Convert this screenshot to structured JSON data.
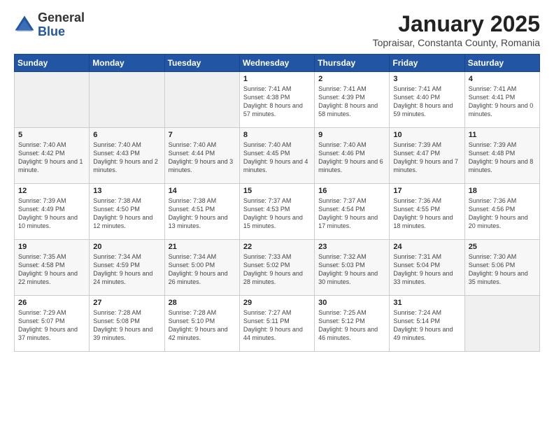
{
  "logo": {
    "general": "General",
    "blue": "Blue"
  },
  "header": {
    "title": "January 2025",
    "subtitle": "Topraisar, Constanta County, Romania"
  },
  "weekdays": [
    "Sunday",
    "Monday",
    "Tuesday",
    "Wednesday",
    "Thursday",
    "Friday",
    "Saturday"
  ],
  "weeks": [
    [
      {
        "day": "",
        "info": ""
      },
      {
        "day": "",
        "info": ""
      },
      {
        "day": "",
        "info": ""
      },
      {
        "day": "1",
        "info": "Sunrise: 7:41 AM\nSunset: 4:38 PM\nDaylight: 8 hours and 57 minutes."
      },
      {
        "day": "2",
        "info": "Sunrise: 7:41 AM\nSunset: 4:39 PM\nDaylight: 8 hours and 58 minutes."
      },
      {
        "day": "3",
        "info": "Sunrise: 7:41 AM\nSunset: 4:40 PM\nDaylight: 8 hours and 59 minutes."
      },
      {
        "day": "4",
        "info": "Sunrise: 7:41 AM\nSunset: 4:41 PM\nDaylight: 9 hours and 0 minutes."
      }
    ],
    [
      {
        "day": "5",
        "info": "Sunrise: 7:40 AM\nSunset: 4:42 PM\nDaylight: 9 hours and 1 minute."
      },
      {
        "day": "6",
        "info": "Sunrise: 7:40 AM\nSunset: 4:43 PM\nDaylight: 9 hours and 2 minutes."
      },
      {
        "day": "7",
        "info": "Sunrise: 7:40 AM\nSunset: 4:44 PM\nDaylight: 9 hours and 3 minutes."
      },
      {
        "day": "8",
        "info": "Sunrise: 7:40 AM\nSunset: 4:45 PM\nDaylight: 9 hours and 4 minutes."
      },
      {
        "day": "9",
        "info": "Sunrise: 7:40 AM\nSunset: 4:46 PM\nDaylight: 9 hours and 6 minutes."
      },
      {
        "day": "10",
        "info": "Sunrise: 7:39 AM\nSunset: 4:47 PM\nDaylight: 9 hours and 7 minutes."
      },
      {
        "day": "11",
        "info": "Sunrise: 7:39 AM\nSunset: 4:48 PM\nDaylight: 9 hours and 8 minutes."
      }
    ],
    [
      {
        "day": "12",
        "info": "Sunrise: 7:39 AM\nSunset: 4:49 PM\nDaylight: 9 hours and 10 minutes."
      },
      {
        "day": "13",
        "info": "Sunrise: 7:38 AM\nSunset: 4:50 PM\nDaylight: 9 hours and 12 minutes."
      },
      {
        "day": "14",
        "info": "Sunrise: 7:38 AM\nSunset: 4:51 PM\nDaylight: 9 hours and 13 minutes."
      },
      {
        "day": "15",
        "info": "Sunrise: 7:37 AM\nSunset: 4:53 PM\nDaylight: 9 hours and 15 minutes."
      },
      {
        "day": "16",
        "info": "Sunrise: 7:37 AM\nSunset: 4:54 PM\nDaylight: 9 hours and 17 minutes."
      },
      {
        "day": "17",
        "info": "Sunrise: 7:36 AM\nSunset: 4:55 PM\nDaylight: 9 hours and 18 minutes."
      },
      {
        "day": "18",
        "info": "Sunrise: 7:36 AM\nSunset: 4:56 PM\nDaylight: 9 hours and 20 minutes."
      }
    ],
    [
      {
        "day": "19",
        "info": "Sunrise: 7:35 AM\nSunset: 4:58 PM\nDaylight: 9 hours and 22 minutes."
      },
      {
        "day": "20",
        "info": "Sunrise: 7:34 AM\nSunset: 4:59 PM\nDaylight: 9 hours and 24 minutes."
      },
      {
        "day": "21",
        "info": "Sunrise: 7:34 AM\nSunset: 5:00 PM\nDaylight: 9 hours and 26 minutes."
      },
      {
        "day": "22",
        "info": "Sunrise: 7:33 AM\nSunset: 5:02 PM\nDaylight: 9 hours and 28 minutes."
      },
      {
        "day": "23",
        "info": "Sunrise: 7:32 AM\nSunset: 5:03 PM\nDaylight: 9 hours and 30 minutes."
      },
      {
        "day": "24",
        "info": "Sunrise: 7:31 AM\nSunset: 5:04 PM\nDaylight: 9 hours and 33 minutes."
      },
      {
        "day": "25",
        "info": "Sunrise: 7:30 AM\nSunset: 5:06 PM\nDaylight: 9 hours and 35 minutes."
      }
    ],
    [
      {
        "day": "26",
        "info": "Sunrise: 7:29 AM\nSunset: 5:07 PM\nDaylight: 9 hours and 37 minutes."
      },
      {
        "day": "27",
        "info": "Sunrise: 7:28 AM\nSunset: 5:08 PM\nDaylight: 9 hours and 39 minutes."
      },
      {
        "day": "28",
        "info": "Sunrise: 7:28 AM\nSunset: 5:10 PM\nDaylight: 9 hours and 42 minutes."
      },
      {
        "day": "29",
        "info": "Sunrise: 7:27 AM\nSunset: 5:11 PM\nDaylight: 9 hours and 44 minutes."
      },
      {
        "day": "30",
        "info": "Sunrise: 7:25 AM\nSunset: 5:12 PM\nDaylight: 9 hours and 46 minutes."
      },
      {
        "day": "31",
        "info": "Sunrise: 7:24 AM\nSunset: 5:14 PM\nDaylight: 9 hours and 49 minutes."
      },
      {
        "day": "",
        "info": ""
      }
    ]
  ]
}
